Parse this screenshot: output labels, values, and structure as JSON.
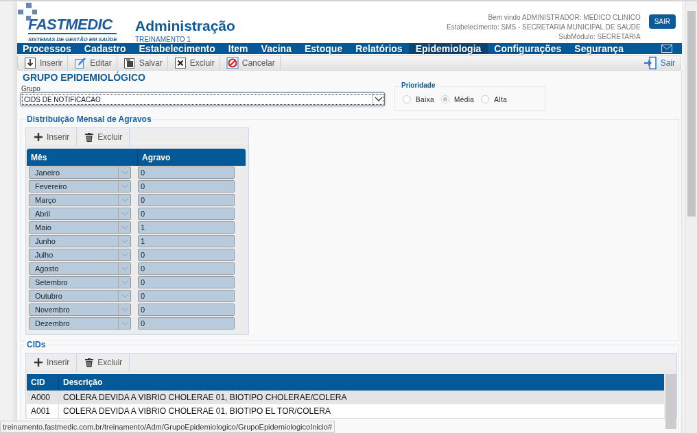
{
  "header": {
    "logo_tagline": "SISTEMAS DE GESTÃO EM SAÚDE",
    "logo_name": "FASTMEDIC",
    "title": "Administração",
    "subtitle": "TREINAMENTO 1",
    "user_lines": [
      "Bem vindo ADMINISTRADOR: MEDICO CLINICO",
      "Estabelecimento: SMS - SECRETARIA MUNICIPAL DE SAUDE",
      "SubMódulo: SECRETARIA"
    ],
    "logout_button": "SAIR"
  },
  "menu": [
    {
      "label": "Processos",
      "selected": false
    },
    {
      "label": "Cadastro",
      "selected": false
    },
    {
      "label": "Estabelecimento",
      "selected": false
    },
    {
      "label": "Item",
      "selected": false
    },
    {
      "label": "Vacina",
      "selected": false
    },
    {
      "label": "Estoque",
      "selected": false
    },
    {
      "label": "Relatórios",
      "selected": false
    },
    {
      "label": "Epidemiologia",
      "selected": true
    },
    {
      "label": "Configurações",
      "selected": false
    },
    {
      "label": "Segurança",
      "selected": false
    }
  ],
  "toolbar": [
    {
      "label": "Inserir",
      "kind": "insert"
    },
    {
      "label": "Editar",
      "kind": "edit"
    },
    {
      "label": "Salvar",
      "kind": "save"
    },
    {
      "label": "Excluir",
      "kind": "delete"
    },
    {
      "label": "Cancelar",
      "kind": "cancel"
    }
  ],
  "exit_button": "Sair",
  "section_title": "GRUPO EPIDEMIOLÓGICO",
  "group": {
    "label": "Grupo",
    "value": "CIDS DE NOTIFICACAO"
  },
  "priority": {
    "title": "Prioridade",
    "options": [
      {
        "label": "Baixa",
        "selected": false
      },
      {
        "label": "Média",
        "selected": true
      },
      {
        "label": "Alta",
        "selected": false
      }
    ]
  },
  "monthly": {
    "title": "Distribuição Mensal de Agravos",
    "actions": [
      "Inserir",
      "Excluir"
    ],
    "columns": [
      "Mês",
      "Agravo"
    ],
    "rows": [
      {
        "month": "Janeiro",
        "value": "0"
      },
      {
        "month": "Fevereiro",
        "value": "0"
      },
      {
        "month": "Março",
        "value": "0"
      },
      {
        "month": "Abril",
        "value": "0"
      },
      {
        "month": "Maio",
        "value": "1"
      },
      {
        "month": "Junho",
        "value": "1"
      },
      {
        "month": "Julho",
        "value": "0"
      },
      {
        "month": "Agosto",
        "value": "0"
      },
      {
        "month": "Setembro",
        "value": "0"
      },
      {
        "month": "Outubro",
        "value": "0"
      },
      {
        "month": "Novembro",
        "value": "0"
      },
      {
        "month": "Dezembro",
        "value": "0"
      }
    ]
  },
  "cids": {
    "title": "CIDs",
    "actions": [
      "Inserir",
      "Excluir"
    ],
    "columns": [
      "CID",
      "Descrição"
    ],
    "rows": [
      {
        "code": "A000",
        "description": "COLERA DEVIDA A VIBRIO CHOLERAE 01, BIOTIPO CHOLERAE/COLERA"
      },
      {
        "code": "A001",
        "description": "COLERA DEVIDA A VIBRIO CHOLERAE 01, BIOTIPO EL TOR/COLERA"
      }
    ]
  },
  "status_url": "treinamento.fastmedic.com.br/treinamento/Adm/GrupoEpidemiologico/GrupoEpidemiologicoInicio#"
}
